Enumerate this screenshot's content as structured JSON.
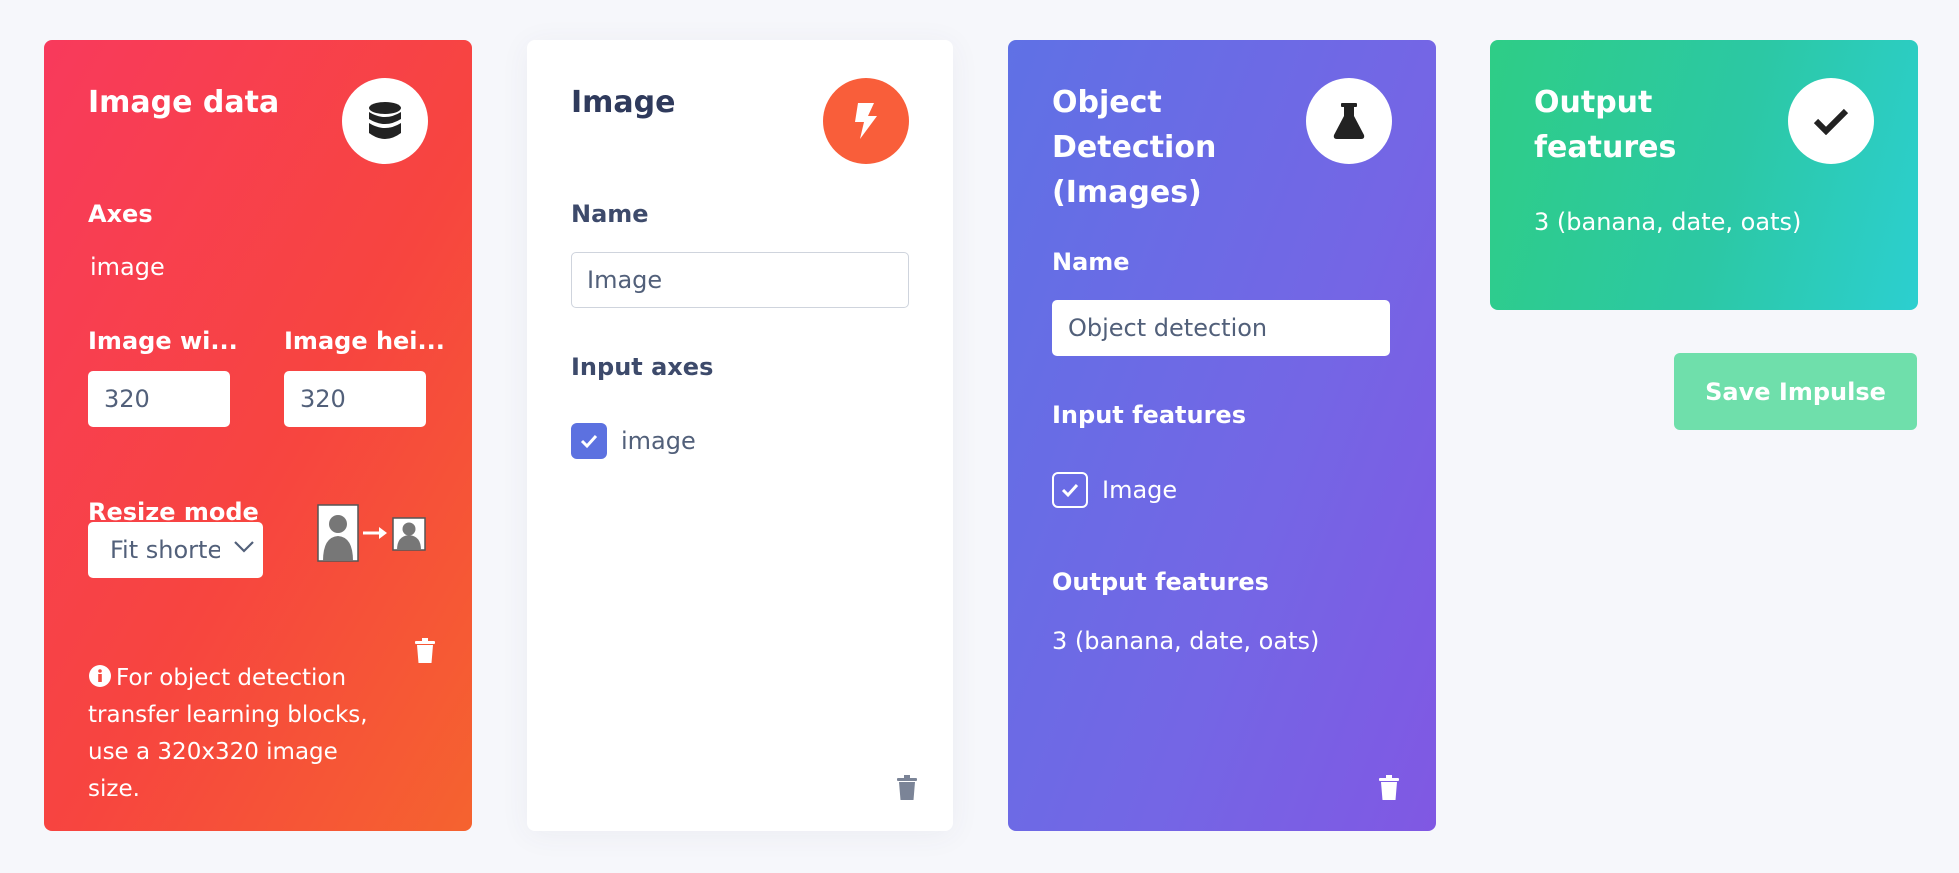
{
  "colors": {
    "red_card_start": "#f83a5c",
    "red_card_end": "#f5632f",
    "purple_card_start": "#5f71e5",
    "purple_card_end": "#8058e3",
    "green_card_start": "#2ecd86",
    "green_card_end": "#2ccfd0",
    "orange_icon": "#f95e3a",
    "checkbox_blue": "#5c71e0",
    "save_button": "#6fdfab"
  },
  "image_data": {
    "title": "Image data",
    "icon": "database-icon",
    "axes_label": "Axes",
    "axes_value": "image",
    "width_label": "Image wi...",
    "width_value": "320",
    "height_label": "Image hei...",
    "height_value": "320",
    "resize_label": "Resize mode",
    "resize_value": "Fit shortest axis",
    "resize_visible": "Fit shorte",
    "info_text": "For object detection transfer learning blocks, use a 320x320 image size."
  },
  "processing": {
    "title": "Image",
    "icon": "lightning-icon",
    "name_label": "Name",
    "name_value": "Image",
    "input_axes_label": "Input axes",
    "axis_item": "image"
  },
  "learning": {
    "title_lines": [
      "Object",
      "Detection",
      "(Images)"
    ],
    "icon": "flask-icon",
    "name_label": "Name",
    "name_value": "Object detection",
    "input_features_label": "Input features",
    "input_feature_item": "Image",
    "output_features_label": "Output features",
    "output_features_value": "3 (banana, date, oats)"
  },
  "output": {
    "title_lines": [
      "Output",
      "features"
    ],
    "icon": "check-icon",
    "value": "3 (banana, date, oats)"
  },
  "save_button_label": "Save Impulse"
}
